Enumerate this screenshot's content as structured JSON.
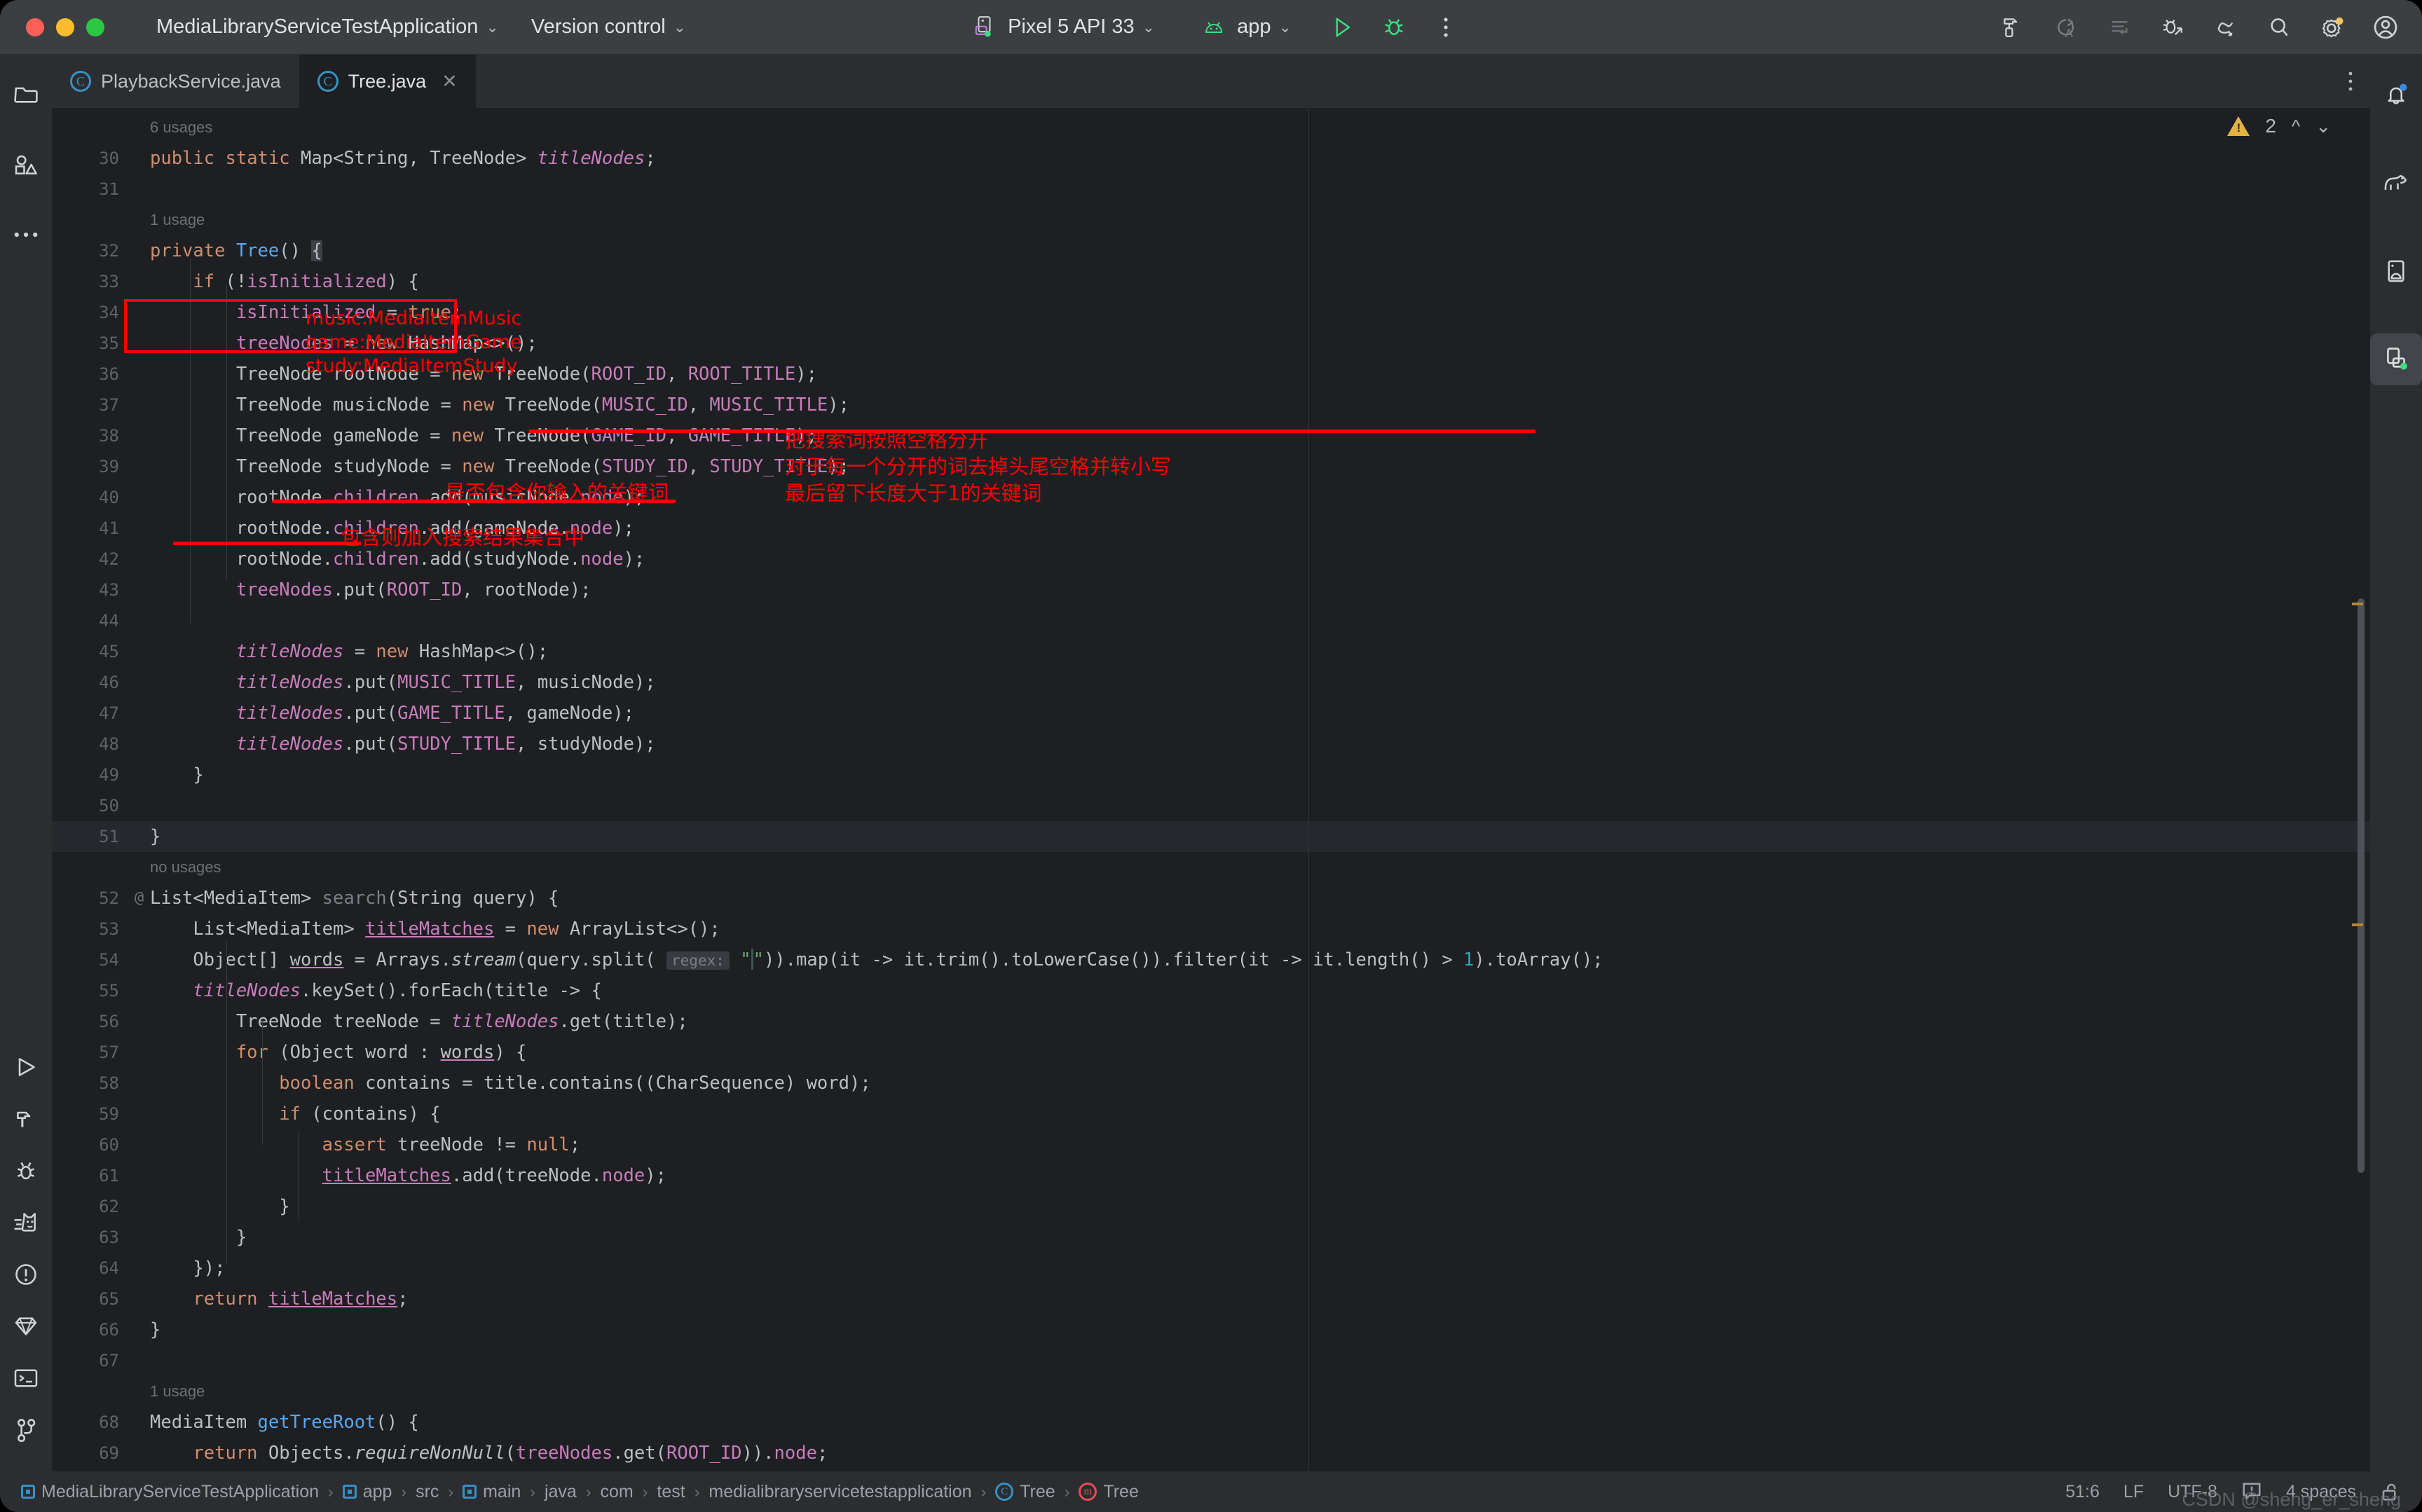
{
  "window": {
    "project_name": "MediaLibraryServiceTestApplication",
    "version_control_label": "Version control",
    "device_label": "Pixel 5 API 33",
    "run_config_label": "app"
  },
  "titlebar_icons": {
    "run": "run-icon",
    "debug": "debug-icon",
    "more": "more-vertical-icon",
    "build": "build-hammer-icon",
    "translate": "translate-icon",
    "format": "reformat-icon",
    "attach_debugger": "attach-debugger-icon",
    "profiler": "profiler-icon",
    "search": "search-icon",
    "settings": "settings-gear-icon",
    "account": "account-avatar-icon"
  },
  "left_rail": {
    "items": [
      {
        "name": "project-tool-window",
        "icon": "folder-icon"
      },
      {
        "name": "resource-manager",
        "icon": "shapes-icon"
      },
      {
        "name": "more-tool-windows",
        "icon": "ellipsis-icon"
      },
      {
        "name": "run-tool-window",
        "icon": "run-triangle-icon"
      },
      {
        "name": "build-tool-window",
        "icon": "hammer-icon"
      },
      {
        "name": "debug-tool-window",
        "icon": "bug-icon"
      },
      {
        "name": "logcat-tool-window",
        "icon": "logcat-cat-icon"
      },
      {
        "name": "problems-tool-window",
        "icon": "exclamation-circle-icon"
      },
      {
        "name": "app-quality-insights",
        "icon": "diamond-icon"
      },
      {
        "name": "terminal-tool-window",
        "icon": "terminal-icon"
      },
      {
        "name": "version-control-tool-window",
        "icon": "branch-icon"
      }
    ]
  },
  "right_rail": {
    "items": [
      {
        "name": "notifications",
        "icon": "bell-icon",
        "badge": true
      },
      {
        "name": "gradle",
        "icon": "gradle-elephant-icon",
        "badge": false
      },
      {
        "name": "device-manager",
        "icon": "device-android-icon",
        "badge": false
      },
      {
        "name": "running-devices",
        "icon": "running-devices-icon",
        "badge": true,
        "selected": true
      }
    ]
  },
  "tabs": [
    {
      "label": "PlaybackService.java",
      "icon": "java-class-icon",
      "active": false,
      "closable": false
    },
    {
      "label": "Tree.java",
      "icon": "java-class-icon",
      "active": true,
      "closable": true
    }
  ],
  "inspections": {
    "warning_count": "2",
    "prev_label": "⌃",
    "next_label": "⌄"
  },
  "editor": {
    "lines": [
      {
        "n": "30",
        "hint": "6 usages",
        "indent": 0
      },
      {
        "n": "31",
        "hint": null,
        "indent": 0
      },
      {
        "n": "32",
        "hint": "1 usage",
        "indent": 0
      },
      {
        "n": "33",
        "hint": null,
        "indent": 1
      },
      {
        "n": "34",
        "hint": null,
        "indent": 2
      },
      {
        "n": "35",
        "hint": null,
        "indent": 2
      },
      {
        "n": "36",
        "hint": null,
        "indent": 2
      },
      {
        "n": "37",
        "hint": null,
        "indent": 2
      },
      {
        "n": "38",
        "hint": null,
        "indent": 2
      },
      {
        "n": "39",
        "hint": null,
        "indent": 2
      },
      {
        "n": "40",
        "hint": null,
        "indent": 2
      },
      {
        "n": "41",
        "hint": null,
        "indent": 2
      },
      {
        "n": "42",
        "hint": null,
        "indent": 2
      },
      {
        "n": "43",
        "hint": null,
        "indent": 2
      },
      {
        "n": "44",
        "hint": null,
        "indent": 2
      },
      {
        "n": "45",
        "hint": null,
        "indent": 2
      },
      {
        "n": "46",
        "hint": null,
        "indent": 2
      },
      {
        "n": "47",
        "hint": null,
        "indent": 2
      },
      {
        "n": "48",
        "hint": null,
        "indent": 2
      },
      {
        "n": "49",
        "hint": null,
        "indent": 1
      },
      {
        "n": "50",
        "hint": null,
        "indent": 0
      },
      {
        "n": "51",
        "hint": null,
        "indent": 0
      },
      {
        "n": "52",
        "hint": "no usages",
        "indent": 0
      },
      {
        "n": "53",
        "hint": null,
        "indent": 1
      },
      {
        "n": "54",
        "hint": null,
        "indent": 1
      },
      {
        "n": "55",
        "hint": null,
        "indent": 1
      },
      {
        "n": "56",
        "hint": null,
        "indent": 2
      },
      {
        "n": "57",
        "hint": null,
        "indent": 2
      },
      {
        "n": "58",
        "hint": null,
        "indent": 3
      },
      {
        "n": "59",
        "hint": null,
        "indent": 3
      },
      {
        "n": "60",
        "hint": null,
        "indent": 4
      },
      {
        "n": "61",
        "hint": null,
        "indent": 4
      },
      {
        "n": "62",
        "hint": null,
        "indent": 3
      },
      {
        "n": "63",
        "hint": null,
        "indent": 2
      },
      {
        "n": "64",
        "hint": null,
        "indent": 1
      },
      {
        "n": "65",
        "hint": null,
        "indent": 1
      },
      {
        "n": "66",
        "hint": null,
        "indent": 0
      },
      {
        "n": "67",
        "hint": null,
        "indent": 0
      },
      {
        "n": "68",
        "hint": "1 usage",
        "indent": 0
      },
      {
        "n": "69",
        "hint": null,
        "indent": 1
      }
    ],
    "source": [
      "public static Map<String, TreeNode> titleNodes;",
      "",
      "private Tree() {",
      "    if (!isInitialized) {",
      "        isInitialized = true;",
      "        treeNodes = new HashMap<>();",
      "        TreeNode rootNode = new TreeNode(ROOT_ID, ROOT_TITLE);",
      "        TreeNode musicNode = new TreeNode(MUSIC_ID, MUSIC_TITLE);",
      "        TreeNode gameNode = new TreeNode(GAME_ID, GAME_TITLE);",
      "        TreeNode studyNode = new TreeNode(STUDY_ID, STUDY_TITLE);",
      "        rootNode.children.add(musicNode.node);",
      "        rootNode.children.add(gameNode.node);",
      "        rootNode.children.add(studyNode.node);",
      "        treeNodes.put(ROOT_ID, rootNode);",
      "",
      "        titleNodes = new HashMap<>();",
      "        titleNodes.put(MUSIC_TITLE, musicNode);",
      "        titleNodes.put(GAME_TITLE, gameNode);",
      "        titleNodes.put(STUDY_TITLE, studyNode);",
      "    }",
      "",
      "}",
      "List<MediaItem> search(String query) {",
      "    List<MediaItem> titleMatches = new ArrayList<>();",
      "    Object[] words = Arrays.stream(query.split( regex: \" \")).map(it -> it.trim().toLowerCase()).filter(it -> it.length() > 1).toArray();",
      "    titleNodes.keySet().forEach(title -> {",
      "        TreeNode treeNode = titleNodes.get(title);",
      "        for (Object word : words) {",
      "            boolean contains = title.contains((CharSequence) word);",
      "            if (contains) {",
      "                assert treeNode != null;",
      "                titleMatches.add(treeNode.node);",
      "            }",
      "        }",
      "    });",
      "    return titleMatches;",
      "}",
      "",
      "MediaItem getTreeRoot() {",
      "    return Objects.requireNonNull(treeNodes.get(ROOT_ID)).node;"
    ]
  },
  "annotations": {
    "color": "#ff0000",
    "box_note_lines": [
      "music:MediaItemMusic",
      "game:MediaItemGame",
      "study:MediaItemStudy"
    ],
    "note_split": [
      "把搜索词按照空格分开",
      "对于每一个分开的词去掉头尾空格并转小写",
      "最后留下长度大于1的关键词"
    ],
    "note_contains": "是否包含你输入的关键词",
    "note_add": "包含则加入搜索结果集合中"
  },
  "status_bar": {
    "breadcrumbs": [
      {
        "label": "MediaLibraryServiceTestApplication",
        "icon": "module-icon"
      },
      {
        "label": "app",
        "icon": "module-icon"
      },
      {
        "label": "src",
        "icon": null
      },
      {
        "label": "main",
        "icon": "module-icon"
      },
      {
        "label": "java",
        "icon": null
      },
      {
        "label": "com",
        "icon": null
      },
      {
        "label": "test",
        "icon": null
      },
      {
        "label": "medialibraryservicetestapplication",
        "icon": null
      },
      {
        "label": "Tree",
        "icon": "java-class-icon"
      },
      {
        "label": "Tree",
        "icon": "method-icon"
      }
    ],
    "separator": "›",
    "caret_position": "51:6",
    "line_separator": "LF",
    "encoding": "UTF-8",
    "indent": "4 spaces",
    "inspection_icon": "inspection-widget-icon",
    "lock_icon": "unlocked-icon"
  },
  "watermark": "CSDN @sheng_er_sheng"
}
